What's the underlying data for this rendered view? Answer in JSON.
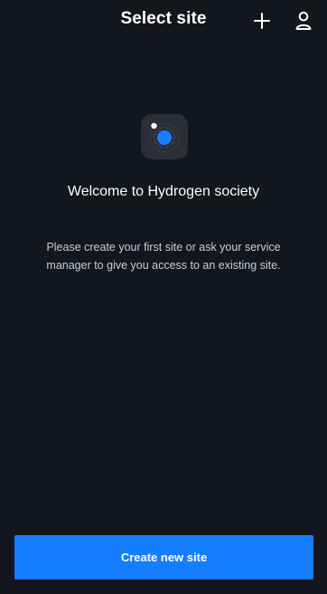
{
  "header": {
    "title": "Select site",
    "add_icon": "plus-icon",
    "profile_icon": "user-icon"
  },
  "welcome": {
    "app_icon": "hydrogen-society-app-icon",
    "title": "Welcome to Hydrogen society",
    "description": "Please create your first site or ask your service manager to give you access to an existing site."
  },
  "actions": {
    "create_site_label": "Create new site"
  },
  "colors": {
    "background": "#14161d",
    "primary": "#157dff",
    "text": "#ffffff",
    "secondary_text": "#c9ccd3"
  }
}
